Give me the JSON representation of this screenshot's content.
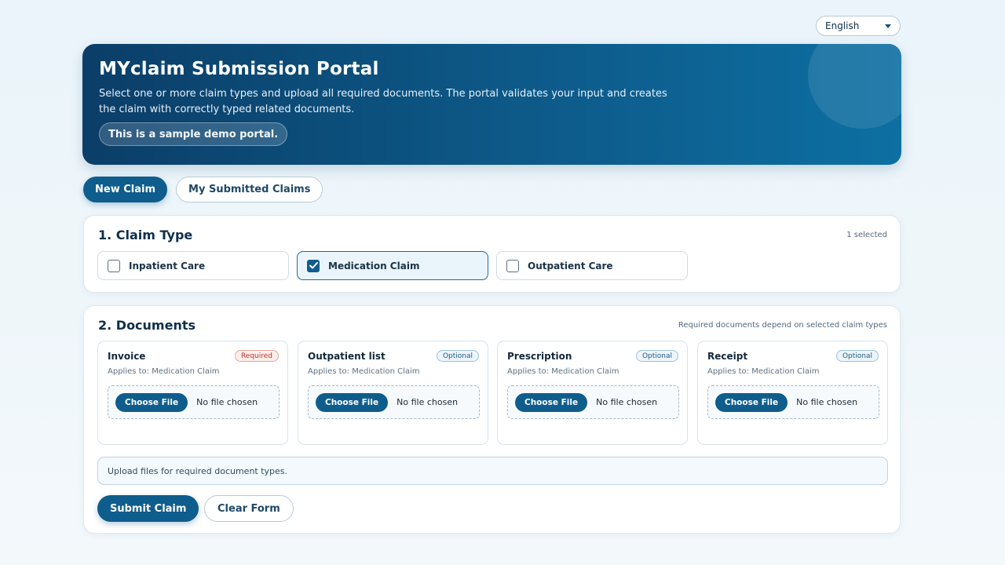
{
  "language": {
    "selected": "English"
  },
  "hero": {
    "title": "MYclaim Submission Portal",
    "description": "Select one or more claim types and upload all required documents. The portal validates your input and creates the claim with correctly typed related documents.",
    "badge": "This is a sample demo portal."
  },
  "tabs": [
    {
      "label": "New Claim",
      "active": true
    },
    {
      "label": "My Submitted Claims",
      "active": false
    }
  ],
  "claim_type": {
    "heading": "1. Claim Type",
    "selected_count": "1 selected",
    "options": [
      {
        "label": "Inpatient Care",
        "checked": false
      },
      {
        "label": "Medication Claim",
        "checked": true
      },
      {
        "label": "Outpatient Care",
        "checked": false
      }
    ]
  },
  "documents": {
    "heading": "2. Documents",
    "note": "Required documents depend on selected claim types",
    "items": [
      {
        "title": "Invoice",
        "tag": "Required",
        "applies": "Applies to: Medication Claim",
        "button": "Choose File",
        "file": "No file chosen"
      },
      {
        "title": "Outpatient list",
        "tag": "Optional",
        "applies": "Applies to: Medication Claim",
        "button": "Choose File",
        "file": "No file chosen"
      },
      {
        "title": "Prescription",
        "tag": "Optional",
        "applies": "Applies to: Medication Claim",
        "button": "Choose File",
        "file": "No file chosen"
      },
      {
        "title": "Receipt",
        "tag": "Optional",
        "applies": "Applies to: Medication Claim",
        "button": "Choose File",
        "file": "No file chosen"
      }
    ],
    "status": "Upload files for required document types."
  },
  "actions": {
    "submit": "Submit Claim",
    "clear": "Clear Form"
  }
}
